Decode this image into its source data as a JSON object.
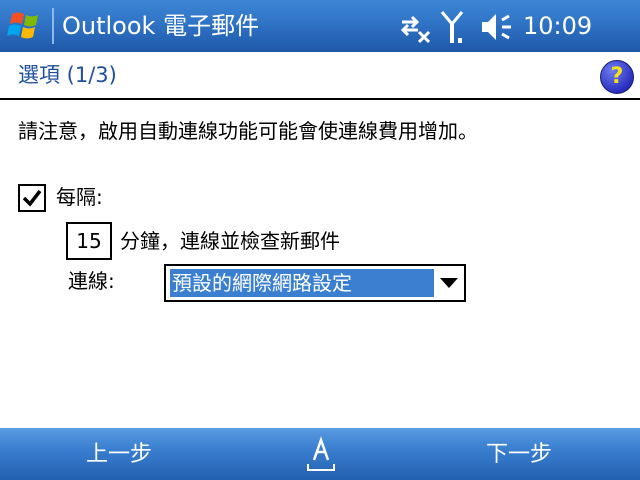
{
  "titlebar": {
    "title": "Outlook 電子郵件",
    "time": "10:09",
    "icons": [
      "windows-flag-icon",
      "sync-disconnected-icon",
      "signal-off-icon",
      "speaker-icon"
    ]
  },
  "header": {
    "caption": "選項 (1/3)",
    "help_symbol": "?"
  },
  "body": {
    "note": "請注意，啟用自動連線功能可能會使連線費用增加。",
    "checkbox_label": "每隔:",
    "checkbox_checked": true,
    "interval_value": "15",
    "interval_label": "分鐘，連線並檢查新郵件",
    "connection_label": "連線:",
    "connection_value": "預設的網際網路設定"
  },
  "bottombar": {
    "left_softkey": "上一步",
    "right_softkey": "下一步"
  },
  "colors": {
    "title_bar": "#2f73c5",
    "selection": "#3a7fd0",
    "caption_text": "#1f4e9a"
  }
}
